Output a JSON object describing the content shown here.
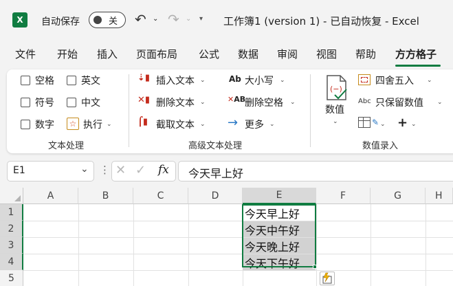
{
  "titlebar": {
    "autosave_label": "自动保存",
    "autosave_state": "关",
    "doc_title": "工作簿1 (version 1)  -  已自动恢复  -  Excel",
    "logo_letter": "X"
  },
  "tabs": [
    "文件",
    "开始",
    "插入",
    "页面布局",
    "公式",
    "数据",
    "审阅",
    "视图",
    "帮助",
    "方方格子"
  ],
  "active_tab": "方方格子",
  "ribbon": {
    "text_group": {
      "label": "文本处理",
      "items": [
        "空格",
        "英文",
        "符号",
        "中文",
        "数字",
        "执行"
      ]
    },
    "adv_group": {
      "label": "高级文本处理",
      "insert": "插入文本",
      "delete": "删除文本",
      "extract": "截取文本",
      "case": "大小写",
      "del_space": "删除空格",
      "more": "更多",
      "case_icon": "Ab",
      "del_space_icon": "AB"
    },
    "num_group": {
      "label": "数值录入",
      "numeric": "数值",
      "round": "四舍五入",
      "keep": "只保留数值",
      "keep_icon": "Abc"
    }
  },
  "formula_bar": {
    "name_box": "E1",
    "fx": "fx",
    "content": "今天早上好"
  },
  "grid": {
    "columns": [
      "A",
      "B",
      "C",
      "D",
      "E",
      "F",
      "G",
      "H"
    ],
    "rows": [
      "1",
      "2",
      "3",
      "4",
      "5"
    ],
    "cells_E": [
      "今天早上好",
      "今天中午好",
      "今天晚上好",
      "今天下午好"
    ]
  },
  "colors": {
    "accent": "#107c41",
    "selection_fill": "#d2d2d2",
    "icon_red": "#c42b1c"
  }
}
